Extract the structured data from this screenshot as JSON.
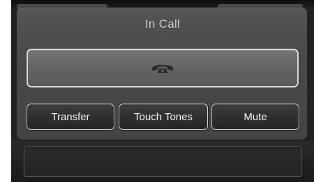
{
  "screen": {
    "title": "In Call"
  },
  "end_call_button": {
    "icon": "phone-hang-up-icon"
  },
  "buttons": {
    "transfer_label": "Transfer",
    "touch_tones_label": "Touch Tones",
    "mute_label": "Mute"
  },
  "status_field": {
    "value": ""
  },
  "colors": {
    "panel": "#4a4a4a",
    "button_border": "#dcdcdc",
    "text": "#f2f2f2",
    "title_text": "#cfcfcf"
  }
}
